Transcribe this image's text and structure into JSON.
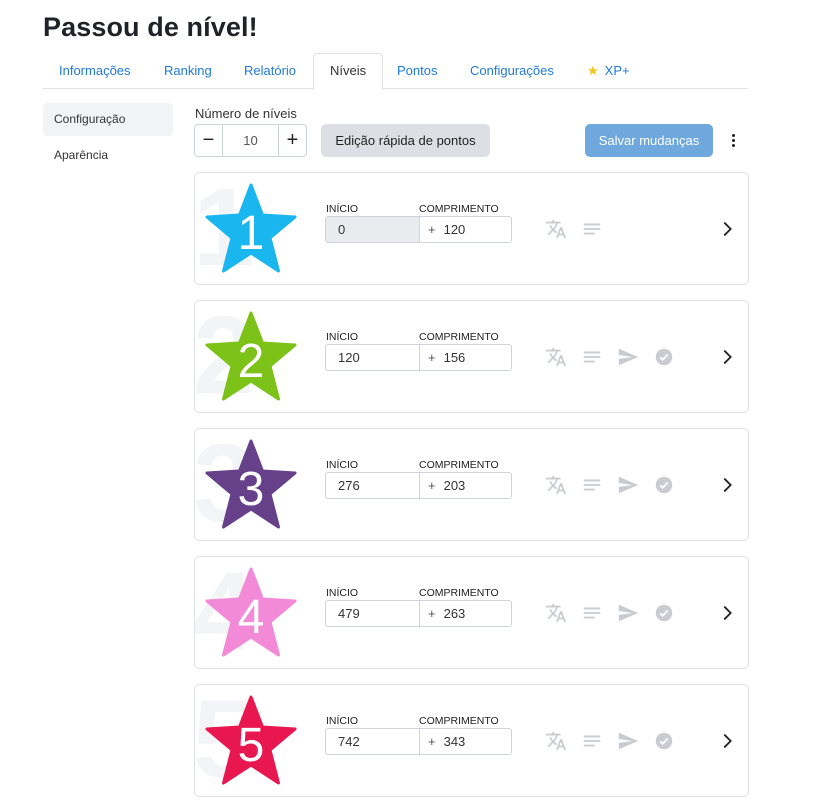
{
  "page_title": "Passou de nível!",
  "tabs": [
    {
      "label": "Informações",
      "active": false
    },
    {
      "label": "Ranking",
      "active": false
    },
    {
      "label": "Relatório",
      "active": false
    },
    {
      "label": "Níveis",
      "active": true
    },
    {
      "label": "Pontos",
      "active": false
    },
    {
      "label": "Configurações",
      "active": false
    },
    {
      "label": "XP+",
      "active": false,
      "icon": "star-icon"
    }
  ],
  "sidebar": {
    "items": [
      {
        "label": "Configuração",
        "active": true
      },
      {
        "label": "Aparência",
        "active": false
      }
    ]
  },
  "toolbar": {
    "levels_label": "Número de níveis",
    "levels_value": "10",
    "minus_symbol": "−",
    "plus_symbol": "+",
    "quick_edit_label": "Edição rápida de pontos",
    "save_label": "Salvar mudanças"
  },
  "field_labels": {
    "start": "INÍCIO",
    "length": "COMPRIMENTO",
    "plus": "+"
  },
  "levels": [
    {
      "number": "1",
      "start": "0",
      "length": "120",
      "color": "#1ab6f0",
      "start_readonly": true,
      "actions": [
        "translate-icon",
        "notes-icon"
      ]
    },
    {
      "number": "2",
      "start": "120",
      "length": "156",
      "color": "#7cc218",
      "start_readonly": false,
      "actions": [
        "translate-icon",
        "notes-icon",
        "send-icon",
        "verified-icon"
      ]
    },
    {
      "number": "3",
      "start": "276",
      "length": "203",
      "color": "#66418a",
      "start_readonly": false,
      "actions": [
        "translate-icon",
        "notes-icon",
        "send-icon",
        "verified-icon"
      ]
    },
    {
      "number": "4",
      "start": "479",
      "length": "263",
      "color": "#f28ad8",
      "start_readonly": false,
      "actions": [
        "translate-icon",
        "notes-icon",
        "send-icon",
        "verified-icon"
      ]
    },
    {
      "number": "5",
      "start": "742",
      "length": "343",
      "color": "#e8174f",
      "start_readonly": false,
      "actions": [
        "translate-icon",
        "notes-icon",
        "send-icon",
        "verified-icon"
      ]
    }
  ]
}
